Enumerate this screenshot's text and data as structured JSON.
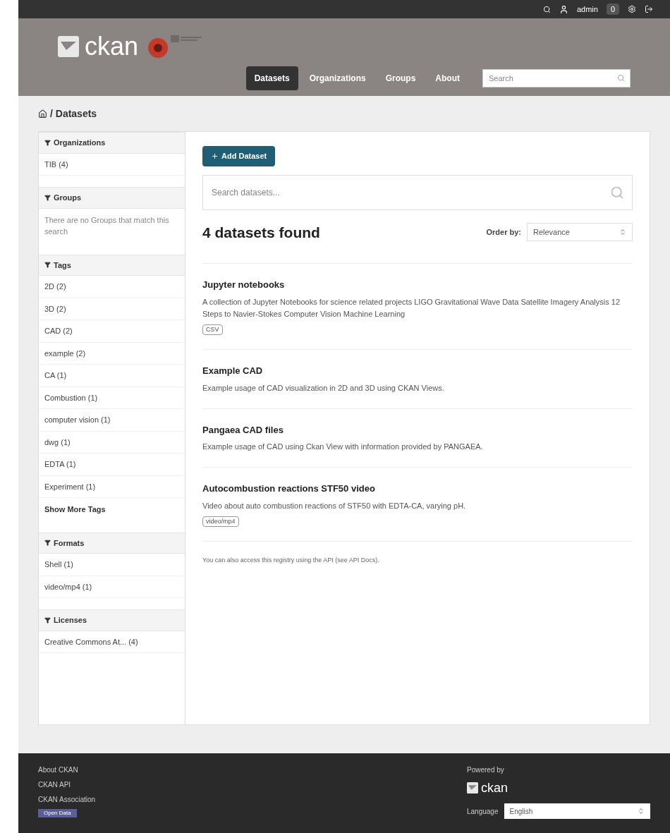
{
  "topbar": {
    "user": "admin",
    "notifications": "0"
  },
  "header": {
    "logo": "ckan",
    "nav": [
      {
        "label": "Datasets",
        "selected": true
      },
      {
        "label": "Organizations",
        "selected": false
      },
      {
        "label": "Groups",
        "selected": false
      },
      {
        "label": "About",
        "selected": false
      }
    ],
    "search": {
      "placeholder": "Search"
    }
  },
  "breadcrumb": "/ Datasets",
  "facets": [
    {
      "title": "Organizations",
      "items": [
        "TIB (4)"
      ]
    },
    {
      "title": "Groups",
      "empty": "There are no Groups that match this search"
    },
    {
      "title": "Tags",
      "items": [
        "2D (2)",
        "3D (2)",
        "CAD (2)",
        "example (2)",
        "CA (1)",
        "Combustion (1)",
        "computer vision (1)",
        "dwg (1)",
        "EDTA (1)",
        "Experiment (1)"
      ],
      "more": "Show More Tags"
    },
    {
      "title": "Formats",
      "items": [
        "Shell (1)",
        "video/mp4 (1)"
      ]
    },
    {
      "title": "Licenses",
      "items": [
        "Creative Commons At... (4)"
      ]
    }
  ],
  "add_button": "Add Dataset",
  "dataset_search": {
    "placeholder": "Search datasets..."
  },
  "count": "4 datasets found",
  "order": {
    "label": "Order by:",
    "value": "Relevance"
  },
  "datasets": [
    {
      "title": "Jupyter notebooks",
      "notes": "A collection of Jupyter Notebooks for science related projects LIGO Gravitational Wave Data Satellite Imagery Analysis 12 Steps to Navier-Stokes Computer Vision Machine Learning",
      "formats": [
        "CSV"
      ]
    },
    {
      "title": "Example CAD",
      "notes": "Example usage of CAD visualization in 2D and 3D using CKAN Views."
    },
    {
      "title": "Pangaea CAD files",
      "notes": "Example usage of CAD using Ckan View with information provided by PANGAEA."
    },
    {
      "title": "Autocombustion reactions STF50 video",
      "notes": "Video about auto combustion reactions of STF50 with EDTA-CA, varying pH.",
      "formats": [
        "video/mp4"
      ]
    }
  ],
  "api_note": "You can also access this registry using the API (see API Docs).",
  "footer": {
    "links": [
      "About CKAN",
      "CKAN API",
      "CKAN Association"
    ],
    "badge": "Open Data",
    "powered": "Powered by",
    "logo": "ckan",
    "language_label": "Language",
    "language": "English"
  }
}
